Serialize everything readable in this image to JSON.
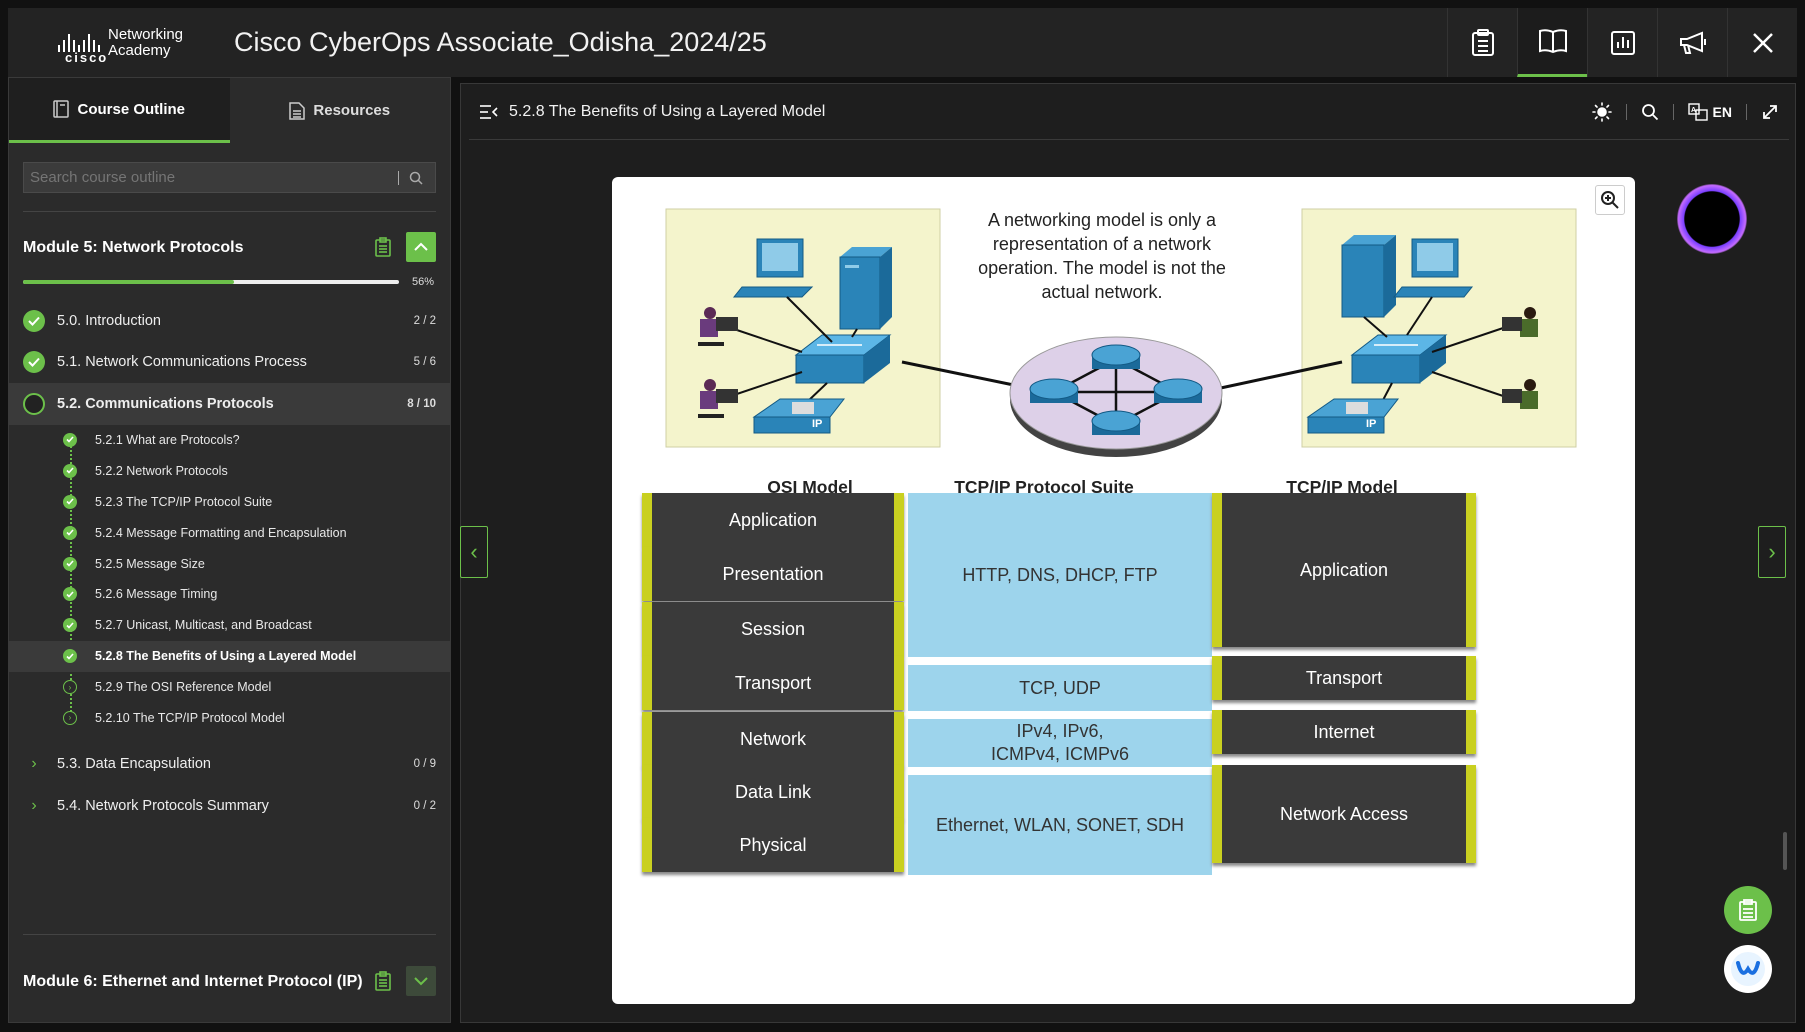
{
  "header": {
    "brand_line1": "Networking",
    "brand_line2": "Academy",
    "brand_word": "cisco",
    "course_title": "Cisco CyberOps Associate_Odisha_2024/25"
  },
  "sidebar": {
    "tabs": [
      {
        "label": "Course Outline",
        "icon": "outline-icon",
        "active": true
      },
      {
        "label": "Resources",
        "icon": "document-icon",
        "active": false
      }
    ],
    "search_placeholder": "Search course outline",
    "module5": {
      "title": "Module 5: Network Protocols",
      "progress_percent": 56,
      "progress_label": "56%"
    },
    "sections": [
      {
        "label": "5.0. Introduction",
        "count": "2 / 2",
        "status": "complete"
      },
      {
        "label": "5.1. Network Communications Process",
        "count": "5 / 6",
        "status": "complete"
      },
      {
        "label": "5.2. Communications Protocols",
        "count": "8 / 10",
        "status": "in-progress"
      }
    ],
    "subitems": [
      {
        "label": "5.2.1 What are Protocols?",
        "status": "complete"
      },
      {
        "label": "5.2.2 Network Protocols",
        "status": "complete"
      },
      {
        "label": "5.2.3 The TCP/IP Protocol Suite",
        "status": "complete"
      },
      {
        "label": "5.2.4 Message Formatting and Encapsulation",
        "status": "complete"
      },
      {
        "label": "5.2.5 Message Size",
        "status": "complete"
      },
      {
        "label": "5.2.6 Message Timing",
        "status": "complete"
      },
      {
        "label": "5.2.7 Unicast, Multicast, and Broadcast",
        "status": "complete"
      },
      {
        "label": "5.2.8 The Benefits of Using a Layered Model",
        "status": "complete"
      },
      {
        "label": "5.2.9 The OSI Reference Model",
        "status": "open"
      },
      {
        "label": "5.2.10 The TCP/IP Protocol Model",
        "status": "open"
      }
    ],
    "sections_after": [
      {
        "label": "5.3. Data Encapsulation",
        "count": "0 / 9"
      },
      {
        "label": "5.4. Network Protocols Summary",
        "count": "0 / 2"
      }
    ],
    "module6": {
      "title": "Module 6: Ethernet and Internet Protocol (IP)"
    }
  },
  "main": {
    "page_title": "5.2.8 The Benefits of Using a Layered Model",
    "language": "EN",
    "figure": {
      "note": "A networking model is only a representation of a network operation. The model is not the actual network.",
      "osi_header": "OSI Model",
      "suite_header": "TCP/IP Protocol Suite",
      "tcpip_header": "TCP/IP Model",
      "osi_layers": [
        "Application",
        "Presentation",
        "Session",
        "Transport",
        "Network",
        "Data Link",
        "Physical"
      ],
      "protocols": [
        "HTTP, DNS, DHCP, FTP",
        "TCP, UDP",
        "IPv4, IPv6,",
        "ICMPv4, ICMPv6",
        "Ethernet, WLAN, SONET, SDH"
      ],
      "tcpip_layers": [
        "Application",
        "Transport",
        "Internet",
        "Network Access"
      ],
      "phone_label": "IP"
    }
  },
  "colors": {
    "accent_green": "#6cc04a",
    "layer_dark": "#3a3a3a",
    "layer_edge": "#c9d020",
    "protocol_blue": "#9dd4ec",
    "network_box": "#f4f4cc"
  }
}
